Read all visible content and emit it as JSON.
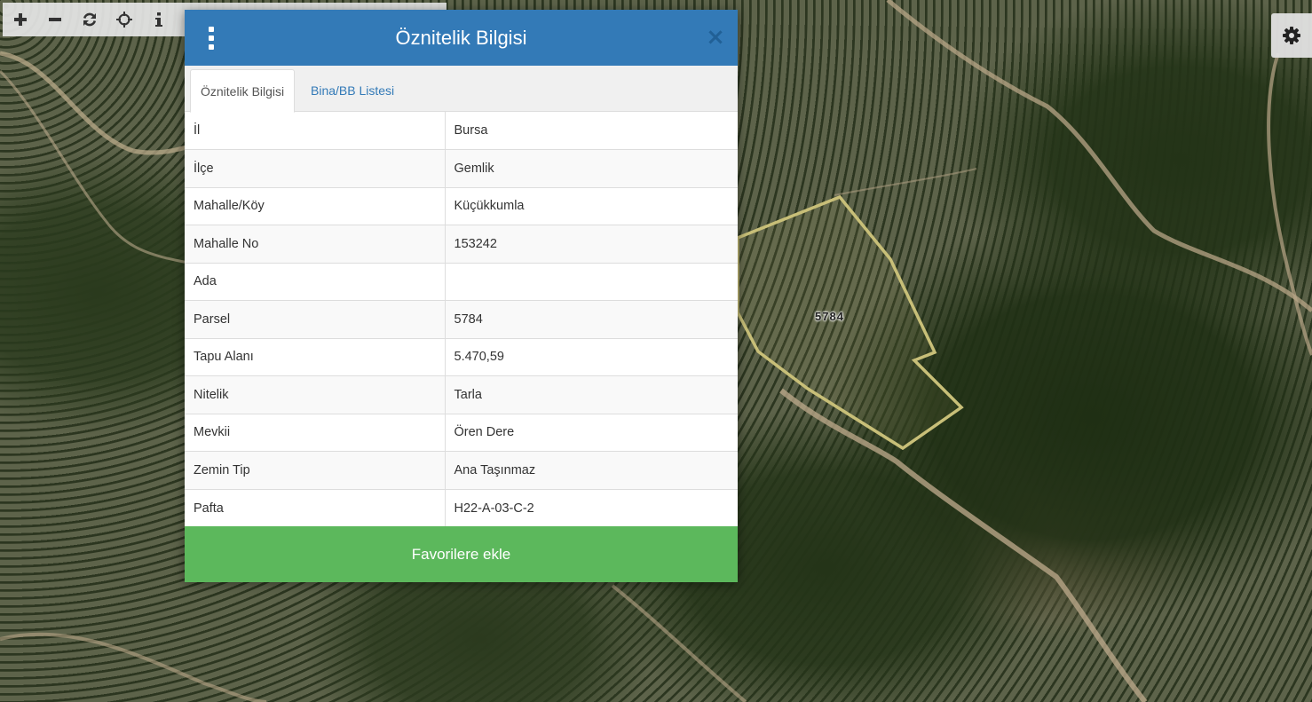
{
  "map": {
    "parcel_label": "5784"
  },
  "toolbar": {
    "tools": [
      "zoom-in",
      "zoom-out",
      "refresh",
      "locate",
      "info"
    ]
  },
  "dialog": {
    "title": "Öznitelik Bilgisi",
    "tabs": [
      {
        "label": "Öznitelik Bilgisi",
        "active": true
      },
      {
        "label": "Bina/BB Listesi",
        "active": false
      }
    ],
    "rows": [
      {
        "key": "İl",
        "value": "Bursa"
      },
      {
        "key": "İlçe",
        "value": "Gemlik"
      },
      {
        "key": "Mahalle/Köy",
        "value": "Küçükkumla"
      },
      {
        "key": "Mahalle No",
        "value": "153242"
      },
      {
        "key": "Ada",
        "value": ""
      },
      {
        "key": "Parsel",
        "value": "5784"
      },
      {
        "key": "Tapu Alanı",
        "value": "5.470,59"
      },
      {
        "key": "Nitelik",
        "value": "Tarla"
      },
      {
        "key": "Mevkii",
        "value": "Ören Dere"
      },
      {
        "key": "Zemin Tip",
        "value": "Ana Taşınmaz"
      },
      {
        "key": "Pafta",
        "value": "H22-A-03-C-2"
      }
    ],
    "favorite_label": "Favorilere ekle"
  },
  "colors": {
    "header": "#337ab7",
    "favorite_button": "#5cb85c",
    "parcel_outline": "#c8bf78"
  }
}
